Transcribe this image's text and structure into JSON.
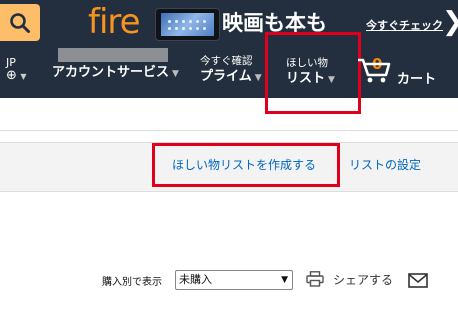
{
  "banner": {
    "fire_text": "fire",
    "headline": "映画も本も",
    "link": "今すぐチェック",
    "arrow": "❯"
  },
  "locale": {
    "code": "JP"
  },
  "nav": {
    "account": {
      "line2": "アカウントサービス"
    },
    "prime": {
      "line1": "今すぐ確認",
      "line2": "プライム"
    },
    "wishlist": {
      "line1": "ほしい物",
      "line2": "リスト"
    },
    "cart": {
      "count": "0",
      "label": "カート"
    }
  },
  "subbar": {
    "create_list": "ほしい物リストを作成する",
    "list_settings": "リストの設定"
  },
  "sort": {
    "label": "購入別で表示",
    "selected": "未購入"
  },
  "share": {
    "label": "シェアする"
  },
  "colors": {
    "nav_bg": "#232f3e",
    "highlight": "#e0001b",
    "link": "#0066c0",
    "fire_orange": "#f7941d"
  }
}
